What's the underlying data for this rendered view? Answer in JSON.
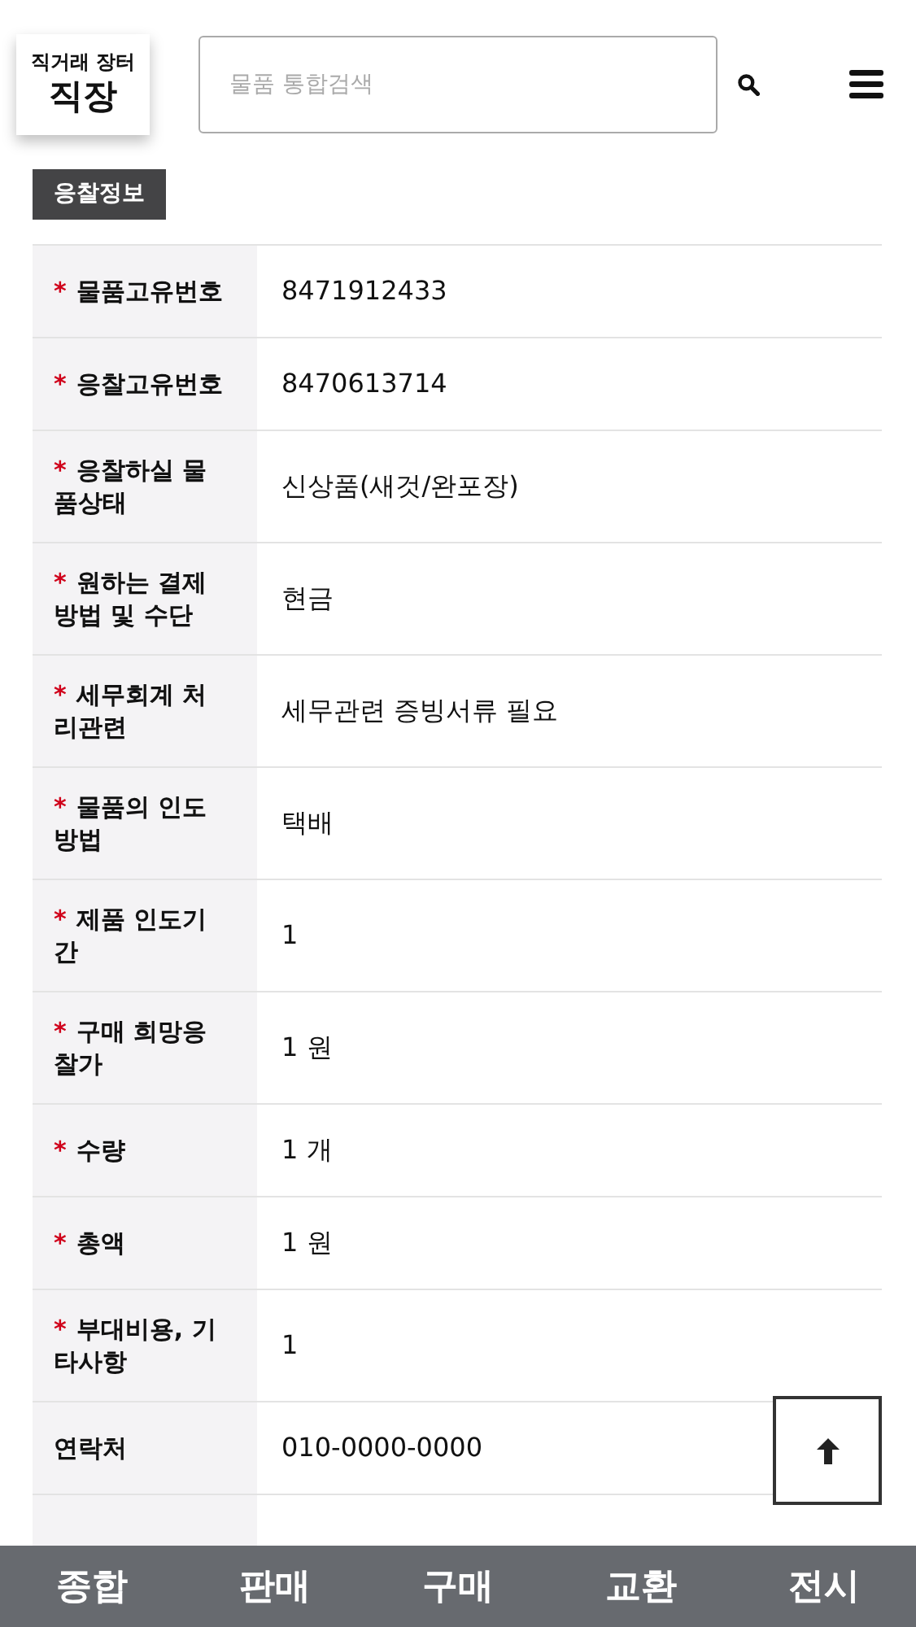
{
  "logo": {
    "tagline": "직거래 장터",
    "name": "직장"
  },
  "search": {
    "placeholder": "물품 통합검색"
  },
  "section_tab": "응찰정보",
  "rows": [
    {
      "label": "물품고유번호",
      "required": true,
      "value": "8471912433"
    },
    {
      "label": "응찰고유번호",
      "required": true,
      "value": "8470613714"
    },
    {
      "label": "응찰하실 물품상태",
      "required": true,
      "value": "신상품(새것/완포장)"
    },
    {
      "label": "원하는 결제 방법 및 수단",
      "required": true,
      "value": "현금"
    },
    {
      "label": "세무회계 처리관련",
      "required": true,
      "value": "세무관련 증빙서류 필요"
    },
    {
      "label": "물품의 인도 방법",
      "required": true,
      "value": "택배"
    },
    {
      "label": "제품 인도기간",
      "required": true,
      "value": "1"
    },
    {
      "label": "구매 희망응찰가",
      "required": true,
      "value": "1 원"
    },
    {
      "label": "수량",
      "required": true,
      "value": "1 개"
    },
    {
      "label": "총액",
      "required": true,
      "value": "1 원"
    },
    {
      "label": "부대비용, 기타사항",
      "required": true,
      "value": "1"
    },
    {
      "label": "연락처",
      "required": false,
      "value": "010-0000-0000"
    }
  ],
  "required_mark": "*",
  "bottom_nav": [
    "종합",
    "판매",
    "구매",
    "교환",
    "전시"
  ]
}
